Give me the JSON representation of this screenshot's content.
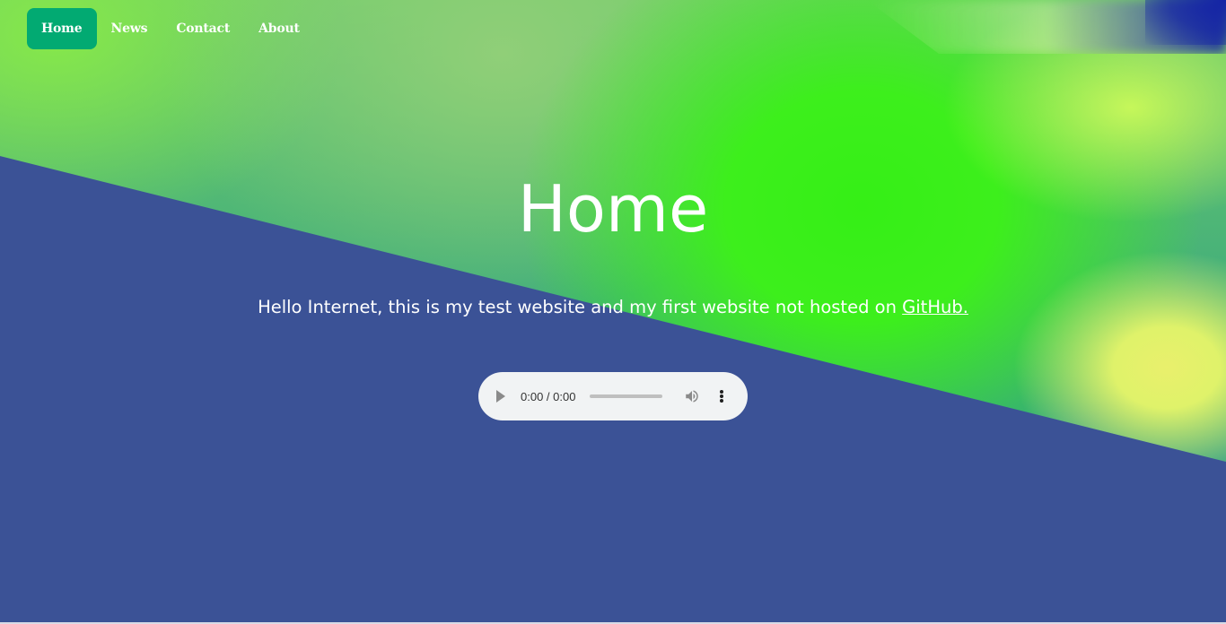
{
  "nav": {
    "items": [
      {
        "label": "Home",
        "active": true
      },
      {
        "label": "News",
        "active": false
      },
      {
        "label": "Contact",
        "active": false
      },
      {
        "label": "About",
        "active": false
      }
    ]
  },
  "hero": {
    "title": "Home",
    "subtitle_text": "Hello Internet, this is my test website and my first website not hosted on ",
    "subtitle_link": "GitHub."
  },
  "audio_player": {
    "time": "0:00 / 0:00",
    "progress": 0,
    "icons": [
      "play-icon",
      "volume-icon",
      "more-options-icon"
    ]
  },
  "colors": {
    "background": "#3b5296",
    "nav_active": "#02aa72",
    "text": "#ffffff",
    "player_bg": "#f1f3f4"
  }
}
